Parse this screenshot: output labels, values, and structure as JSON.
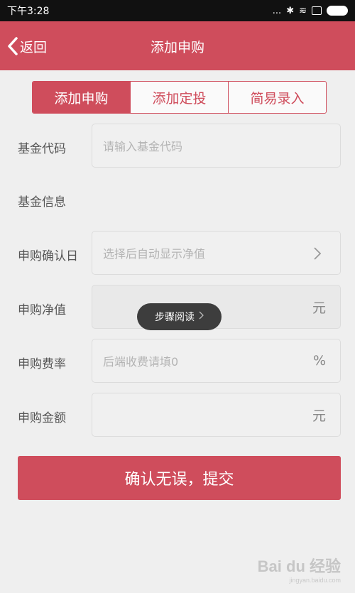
{
  "status_bar": {
    "time": "下午3:28",
    "signal_dots": "...",
    "bluetooth_glyph": "✱",
    "wifi_glyph": "≋"
  },
  "nav": {
    "back_label": "返回",
    "title": "添加申购"
  },
  "tabs": [
    {
      "label": "添加申购",
      "active": true
    },
    {
      "label": "添加定投",
      "active": false
    },
    {
      "label": "简易录入",
      "active": false
    }
  ],
  "form": {
    "fund_code": {
      "label": "基金代码",
      "placeholder": "请输入基金代码"
    },
    "fund_info": {
      "label": "基金信息"
    },
    "confirm_date": {
      "label": "申购确认日",
      "placeholder": "选择后自动显示净值"
    },
    "nav_value": {
      "label": "申购净值",
      "unit": "元"
    },
    "fee_rate": {
      "label": "申购费率",
      "placeholder": "后端收费请填0",
      "unit": "%"
    },
    "amount": {
      "label": "申购金额",
      "unit": "元"
    }
  },
  "toast": {
    "label": "步骤阅读"
  },
  "submit_label": "确认无误，提交",
  "watermark": {
    "brand": "Bai du 经验",
    "url": "jingyan.baidu.com"
  },
  "colors": {
    "accent": "#cf4d5c",
    "background": "#efefef"
  }
}
